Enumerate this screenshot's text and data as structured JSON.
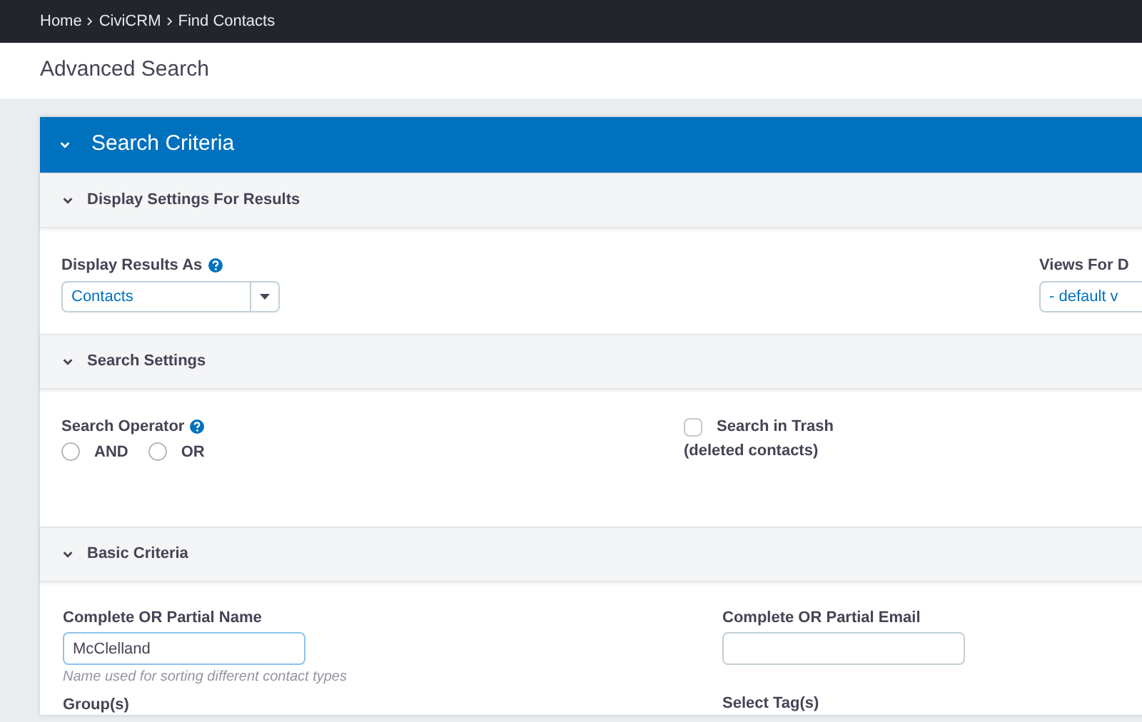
{
  "breadcrumb": [
    {
      "label": "Home"
    },
    {
      "label": "CiviCRM"
    },
    {
      "label": "Find Contacts"
    }
  ],
  "page_title": "Advanced Search",
  "panel": {
    "title": "Search Criteria",
    "expanded": true
  },
  "sections": [
    {
      "kind": "display",
      "title": "Display Settings For Results",
      "expanded": true,
      "display_results_as": {
        "label": "Display Results As",
        "value": "Contacts"
      },
      "views": {
        "label": "Views For D",
        "value": "- default v"
      }
    },
    {
      "kind": "settings",
      "title": "Search Settings",
      "expanded": true,
      "operator": {
        "label": "Search Operator",
        "options": [
          {
            "label": "AND",
            "selected": false
          },
          {
            "label": "OR",
            "selected": false
          }
        ]
      },
      "trash": {
        "label": "Search in Trash",
        "note": "(deleted contacts)",
        "checked": false
      }
    },
    {
      "kind": "basic",
      "title": "Basic Criteria",
      "expanded": true,
      "name": {
        "label": "Complete OR Partial Name",
        "value": "McClelland",
        "help": "Name used for sorting different contact types"
      },
      "email": {
        "label": "Complete OR Partial Email"
      },
      "groups_label": "Group(s)",
      "tags_label": "Select Tag(s)"
    }
  ]
}
